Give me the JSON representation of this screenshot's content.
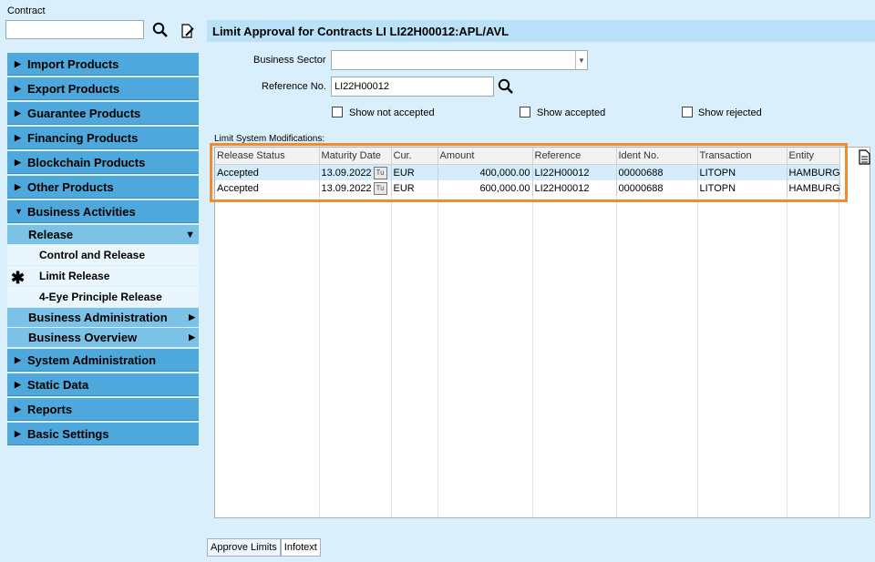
{
  "contract": {
    "label": "Contract",
    "value": ""
  },
  "nav": {
    "items_top": [
      {
        "label": "Import Products"
      },
      {
        "label": "Export Products"
      },
      {
        "label": "Guarantee Products"
      },
      {
        "label": "Financing Products"
      },
      {
        "label": "Blockchain Products"
      },
      {
        "label": "Other Products"
      }
    ],
    "business_activities": "Business Activities",
    "release": "Release",
    "release_items": [
      {
        "label": "Control and Release"
      },
      {
        "label": "Limit Release"
      },
      {
        "label": "4-Eye Principle Release"
      }
    ],
    "business_administration": "Business Administration",
    "business_overview": "Business Overview",
    "items_bottom": [
      {
        "label": "System Administration"
      },
      {
        "label": "Static Data"
      },
      {
        "label": "Reports"
      },
      {
        "label": "Basic Settings"
      }
    ]
  },
  "main": {
    "title": "Limit Approval for Contracts LI LI22H00012:APL/AVL",
    "business_sector_label": "Business Sector",
    "business_sector_value": "",
    "reference_label": "Reference No.",
    "reference_value": "LI22H00012",
    "show_not_accepted": "Show not accepted",
    "show_accepted": "Show accepted",
    "show_rejected": "Show rejected",
    "grid_caption": "Limit System Modifications:",
    "columns": [
      "Release Status",
      "Maturity Date",
      "Cur.",
      "Amount",
      "Reference",
      "Ident No.",
      "Transaction",
      "Entity"
    ],
    "rows": [
      [
        "Accepted",
        "13.09.2022",
        "EUR",
        "400,000.00",
        "LI22H00012",
        "00000688",
        "LITOPN",
        "HAMBURG"
      ],
      [
        "Accepted",
        "13.09.2022",
        "EUR",
        "600,000.00",
        "LI22H00012",
        "00000688",
        "LITOPN",
        "HAMBURG"
      ]
    ]
  },
  "tabs": [
    {
      "label": "Approve Limits"
    },
    {
      "label": "Infotext"
    }
  ],
  "colors": {
    "nav": "#4fa8db",
    "highlight": "#f28a30",
    "background": "#d9effb"
  }
}
